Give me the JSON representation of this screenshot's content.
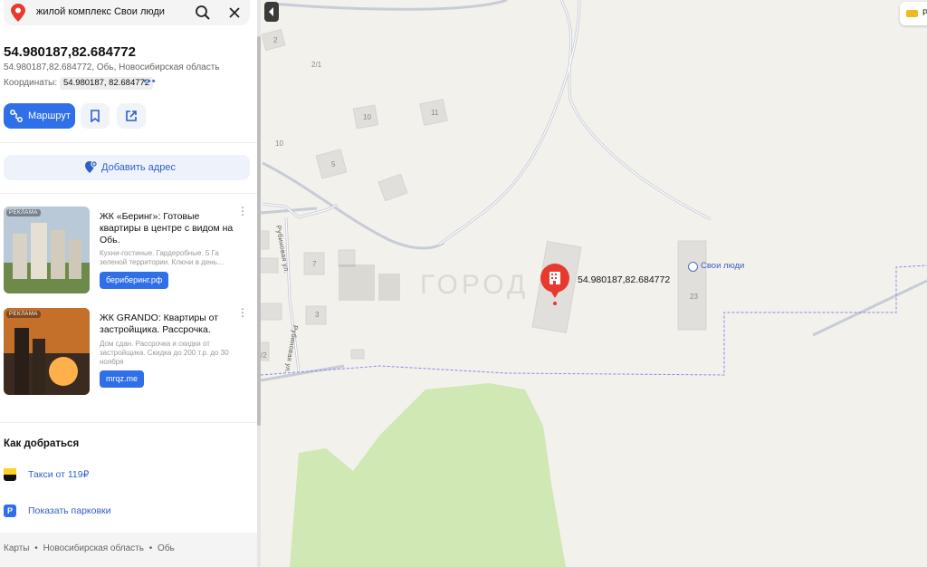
{
  "search": {
    "query": "жилой комплекс Свои люди"
  },
  "place": {
    "title": "54.980187,82.684772",
    "subtitle": "54.980187,82.684772, Обь, Новосибирская область",
    "coords_label": "Координаты:",
    "coords_value": "54.980187, 82.684772"
  },
  "actions": {
    "route_label": "Маршрут"
  },
  "add_address": {
    "label": "Добавить адрес"
  },
  "ads": [
    {
      "tag": "РЕКЛАМА",
      "title": "ЖК «Беринг»: Готовые квартиры в центре с видом на Обь.",
      "desc": "Кухни-гостиные. Гардеробные. 5 Га зеленой территории. Ключи в день…",
      "link": "бериберинг.рф"
    },
    {
      "tag": "РЕКЛАМА",
      "title": "ЖК GRANDO: Квартиры от застройщика. Рассрочка.",
      "desc": "Дом сдан. Рассрочка и скидки от застройщика. Скидка до 200 т.р. до 30 ноября",
      "link": "mrqz.me"
    }
  ],
  "howto": {
    "title": "Как добраться",
    "taxi": "Такси от 119₽",
    "parking": "Показать парковки"
  },
  "footer": {
    "c1": "Карты",
    "c2": "Новосибирская область",
    "c3": "Обь",
    "sep": "•"
  },
  "map": {
    "pin_label": "54.980187,82.684772",
    "poi_label": "Свои люди",
    "watermark": "ГОРОД",
    "street1": "Рубиновая ул.",
    "street2": "Рубиновая ул.",
    "numbers": {
      "n2": "2",
      "n21": "2/1",
      "n10a": "10",
      "n11": "11",
      "n10b": "10",
      "n5": "5",
      "n7": "7",
      "n3": "3",
      "n23": "23",
      "n2b": "/2"
    },
    "topright_text": "Р"
  },
  "colors": {
    "accent": "#2f6fe8",
    "pin": "#e8392f",
    "green": "#cfe8b4",
    "road": "#c5cad6"
  }
}
